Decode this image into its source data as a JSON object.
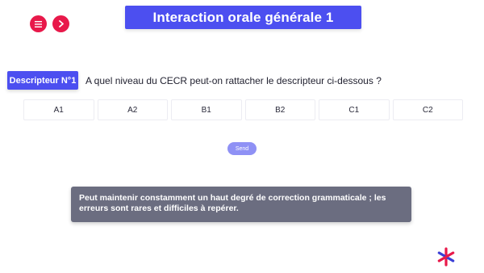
{
  "header": {
    "title": "Interaction orale générale 1",
    "menu_icon": "hamburger-menu-icon",
    "next_icon": "chevron-right-icon"
  },
  "question": {
    "badge": "Descripteur N°1",
    "text": "A quel niveau du CECR peut-on rattacher le descripteur ci-dessous ?"
  },
  "options": [
    "A1",
    "A2",
    "B1",
    "B2",
    "C1",
    "C2"
  ],
  "send_label": "Send",
  "descriptor_text": "Peut maintenir constamment un haut degré de correction grammaticale ; les erreurs sont rares et difficiles à repérer.",
  "colors": {
    "accent": "#4c4ff0",
    "nav_buttons": "#e8194a",
    "send": "#8f91f5",
    "descriptor_box": "#6b6d80",
    "logo_primary": "#e8194a",
    "logo_secondary": "#3b3fd6"
  },
  "logo_icon": "asterisk-logo"
}
